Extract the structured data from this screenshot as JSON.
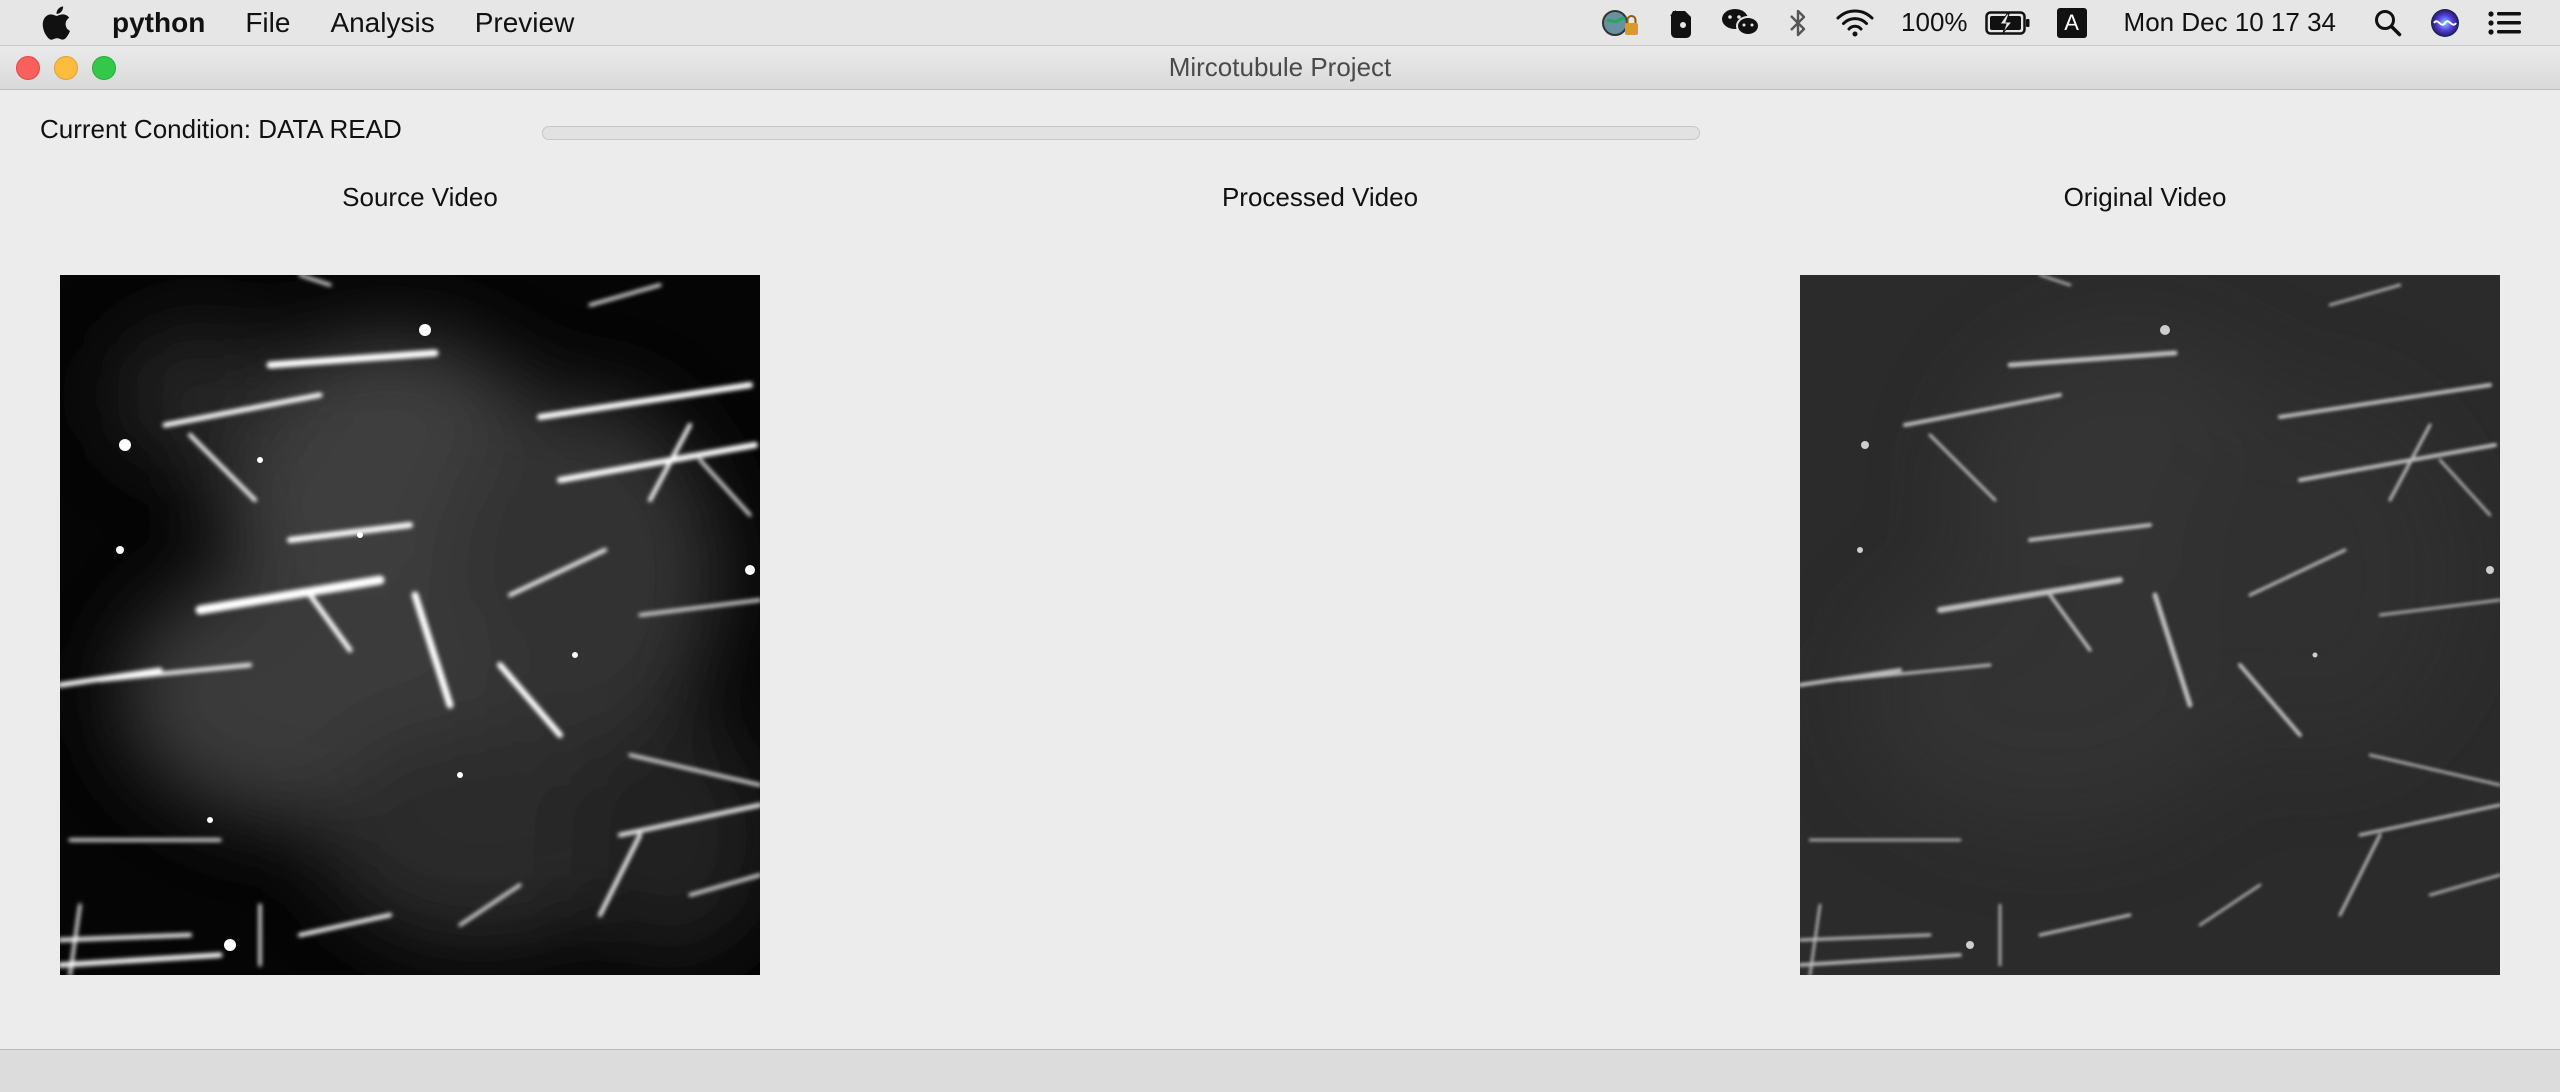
{
  "menubar": {
    "app_name": "python",
    "menus": [
      "File",
      "Analysis",
      "Preview"
    ],
    "battery": "100%",
    "input_source": "A",
    "clock": "Mon Dec 10  17 34"
  },
  "window": {
    "title": "Mircotubule Project",
    "condition_label": "Current Condition: DATA READ",
    "progress": 0
  },
  "panels": {
    "source": "Source Video",
    "processed": "Processed Video",
    "original": "Original Video"
  }
}
